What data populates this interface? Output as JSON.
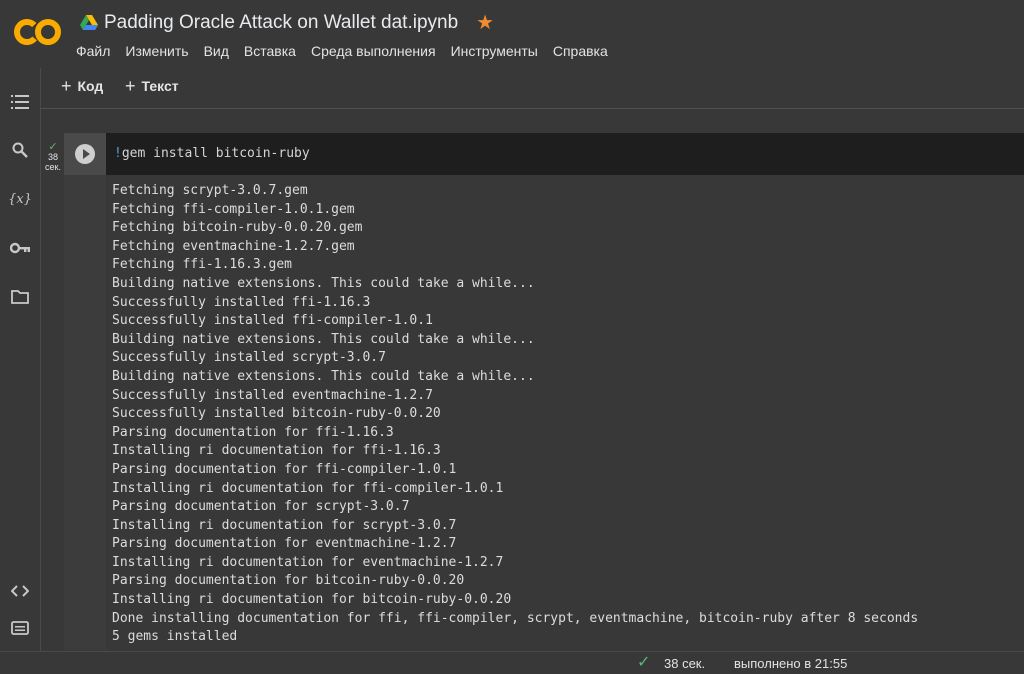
{
  "header": {
    "title": "Padding Oracle Attack on Wallet dat.ipynb",
    "logo_text": "CO",
    "menu": [
      "Файл",
      "Изменить",
      "Вид",
      "Вставка",
      "Среда выполнения",
      "Инструменты",
      "Справка"
    ]
  },
  "toolbar": {
    "add_code_label": "Код",
    "add_text_label": "Текст"
  },
  "cell": {
    "exec_time_value": "38",
    "exec_time_unit": "сек.",
    "code_bang": "!",
    "code_rest": "gem install bitcoin-ruby",
    "output": [
      "Fetching scrypt-3.0.7.gem",
      "Fetching ffi-compiler-1.0.1.gem",
      "Fetching bitcoin-ruby-0.0.20.gem",
      "Fetching eventmachine-1.2.7.gem",
      "Fetching ffi-1.16.3.gem",
      "Building native extensions. This could take a while...",
      "Successfully installed ffi-1.16.3",
      "Successfully installed ffi-compiler-1.0.1",
      "Building native extensions. This could take a while...",
      "Successfully installed scrypt-3.0.7",
      "Building native extensions. This could take a while...",
      "Successfully installed eventmachine-1.2.7",
      "Successfully installed bitcoin-ruby-0.0.20",
      "Parsing documentation for ffi-1.16.3",
      "Installing ri documentation for ffi-1.16.3",
      "Parsing documentation for ffi-compiler-1.0.1",
      "Installing ri documentation for ffi-compiler-1.0.1",
      "Parsing documentation for scrypt-3.0.7",
      "Installing ri documentation for scrypt-3.0.7",
      "Parsing documentation for eventmachine-1.2.7",
      "Installing ri documentation for eventmachine-1.2.7",
      "Parsing documentation for bitcoin-ruby-0.0.20",
      "Installing ri documentation for bitcoin-ruby-0.0.20",
      "Done installing documentation for ffi, ffi-compiler, scrypt, eventmachine, bitcoin-ruby after 8 seconds",
      "5 gems installed"
    ]
  },
  "statusbar": {
    "duration": "38 сек.",
    "completed": "выполнено в 21:55"
  },
  "colors": {
    "accent_green": "#5bb974",
    "star_orange": "#f28b30",
    "logo_orange": "#f9ab00"
  },
  "icons": {
    "rail": [
      "toc-icon",
      "search-icon",
      "variables-icon",
      "key-icon",
      "folder-icon",
      "code-snippets-icon",
      "terminal-icon"
    ]
  }
}
